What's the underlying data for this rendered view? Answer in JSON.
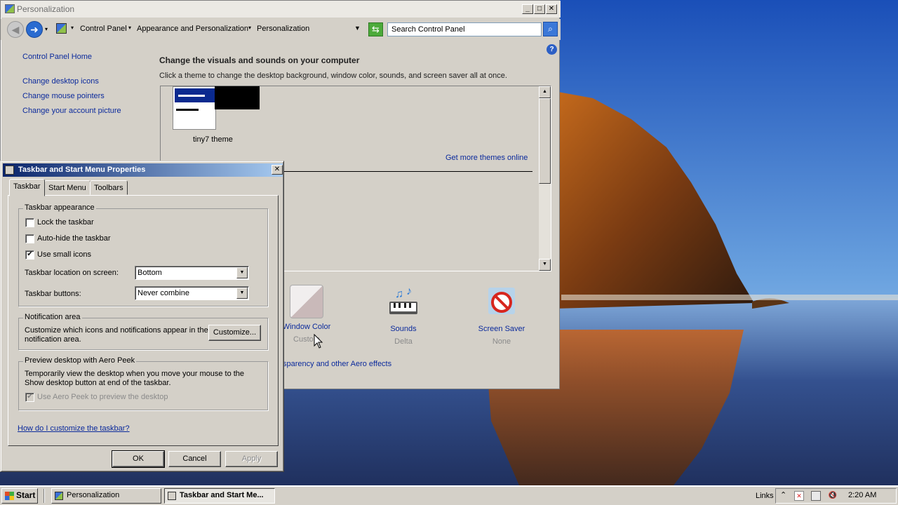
{
  "personalization": {
    "title": "Personalization",
    "breadcrumb": [
      "Control Panel",
      "Appearance and Personalization",
      "Personalization"
    ],
    "search_placeholder": "Search Control Panel",
    "left_links": [
      "Control Panel Home",
      "Change desktop icons",
      "Change mouse pointers",
      "Change your account picture"
    ],
    "heading": "Change the visuals and sounds on your computer",
    "subheading": "Click a theme to change the desktop background, window color, sounds, and screen saver all at once.",
    "theme_name": "tiny7 theme",
    "more_themes": "Get more themes online",
    "tiles": [
      {
        "label": "Window Color",
        "sub": "Custom"
      },
      {
        "label": "Sounds",
        "sub": "Delta"
      },
      {
        "label": "Screen Saver",
        "sub": "None"
      }
    ],
    "aero_link": "sparency and other Aero effects"
  },
  "dialog": {
    "title": "Taskbar and Start Menu Properties",
    "tabs": [
      "Taskbar",
      "Start Menu",
      "Toolbars"
    ],
    "appearance_group": "Taskbar appearance",
    "lock_label": "Lock the taskbar",
    "lock_checked": false,
    "autohide_label": "Auto-hide the taskbar",
    "autohide_checked": false,
    "small_icons_label": "Use small icons",
    "small_icons_checked": true,
    "location_label": "Taskbar location on screen:",
    "location_value": "Bottom",
    "buttons_label": "Taskbar buttons:",
    "buttons_value": "Never combine",
    "notification_group": "Notification area",
    "notification_text": "Customize which icons and notifications appear in the notification area.",
    "customize_button": "Customize...",
    "peek_group": "Preview desktop with Aero Peek",
    "peek_text": "Temporarily view the desktop when you move your mouse to the Show desktop button at end of the taskbar.",
    "peek_check_label": "Use Aero Peek to preview the desktop",
    "help_link": "How do I customize the taskbar?",
    "ok": "OK",
    "cancel": "Cancel",
    "apply": "Apply"
  },
  "taskbar": {
    "start": "Start",
    "items": [
      "Personalization",
      "Taskbar and Start Me..."
    ],
    "links": "Links",
    "clock": "2:20 AM"
  },
  "colors": {
    "title_active": "#0a246a",
    "link": "#0b2a9c",
    "face": "#d4d0c8"
  }
}
